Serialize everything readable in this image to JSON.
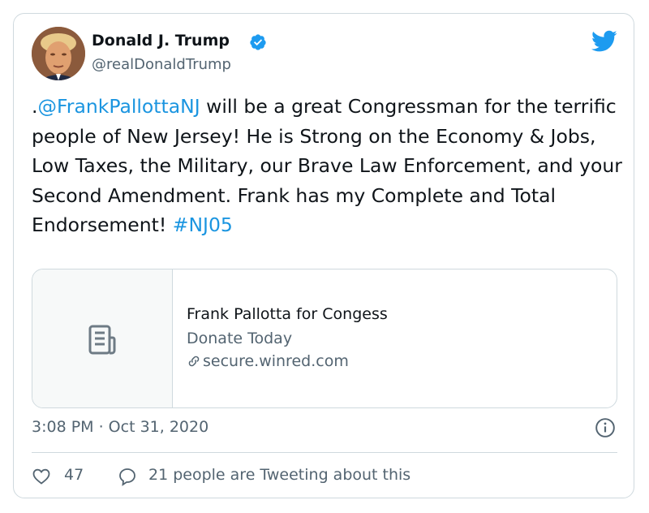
{
  "author": {
    "name": "Donald J. Trump",
    "handle": "@realDonaldTrump",
    "verified": true
  },
  "tweet": {
    "prefix": ".",
    "mention": "@FrankPallottaNJ",
    "body": " will be a great Congressman for the terrific people of New Jersey! He is Strong on the Economy & Jobs, Low Taxes, the Military, our Brave Law Enforcement, and your Second Amendment. Frank has my Complete and Total Endorsement! ",
    "hashtag": "#NJ05"
  },
  "link_card": {
    "title": "Frank Pallotta for Congess",
    "description": "Donate Today",
    "url": "secure.winred.com",
    "thumbnail_icon": "document-icon"
  },
  "meta": {
    "timestamp": "3:08 PM · Oct 31, 2020"
  },
  "actions": {
    "likes": "47",
    "tweeting_text": "21 people are Tweeting about this"
  },
  "colors": {
    "link": "#1b95e0",
    "verified": "#1d9bf0",
    "muted": "#536471",
    "border": "#cfd9de"
  },
  "icons": [
    "verified-badge-icon",
    "twitter-bird-icon",
    "document-icon",
    "link-icon",
    "info-icon",
    "heart-icon",
    "speech-bubble-icon"
  ]
}
